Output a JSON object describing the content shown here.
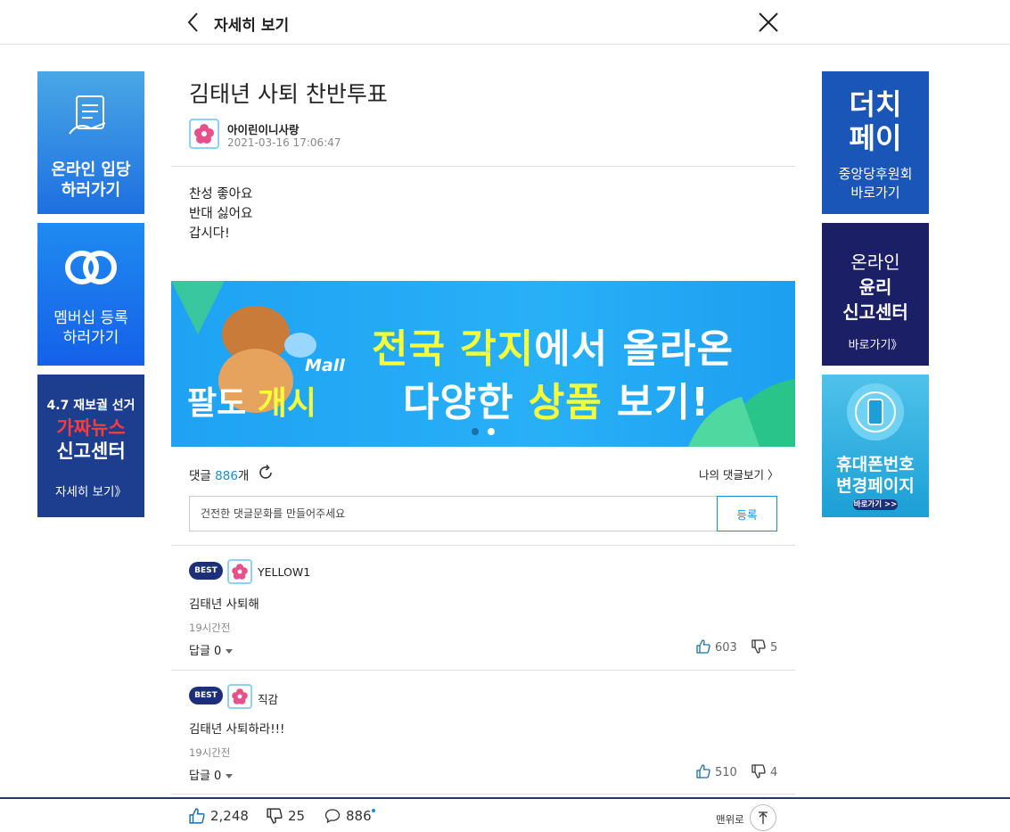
{
  "header": {
    "title": "자세히 보기"
  },
  "article": {
    "title": "김태년 사퇴 찬반투표",
    "author": "아이린이니사랑",
    "date": "2021-03-16 17:06:47",
    "body": [
      "찬성 좋아요",
      "반대 싫어요",
      "갑시다!"
    ]
  },
  "left_banners": [
    {
      "line1": "온라인 입당",
      "line2": "하러가기"
    },
    {
      "line1": "멤버십 등록",
      "line2": "하러가기"
    },
    {
      "line1": "4.7 재보궐 선거",
      "line2": "가짜뉴스",
      "line3": "신고센터",
      "line4": "자세히 보기》"
    }
  ],
  "right_banners": [
    {
      "line1": "더치",
      "line2": "페이",
      "line3": "중앙당후원회",
      "line4": "바로가기"
    },
    {
      "line1": "온라인",
      "line2": "윤리",
      "line3": "신고센터",
      "line4": "바로가기》"
    },
    {
      "line1": "휴대폰번호",
      "line2": "변경페이지",
      "line3": "바로가기 >>"
    }
  ],
  "promo": {
    "brand_a": "팔도 ",
    "brand_b": "개시",
    "mall": "Mall",
    "line1_a": "전국 각지",
    "line1_b": "에서 올라온",
    "line2_a": "다양한 ",
    "line2_b": "상품",
    "line2_c": " 보기!"
  },
  "comments_section": {
    "label": "댓글 ",
    "count": "886",
    "suffix": "개",
    "my_comments": "나의 댓글보기 〉",
    "placeholder": "건전한 댓글문화를 만들어주세요",
    "submit": "등록"
  },
  "comments": [
    {
      "badge": "BEST",
      "name": "YELLOW1",
      "text": "김태년 사퇴해",
      "time": "19시간전",
      "reply": "답글 0",
      "likes": "603",
      "dislikes": "5"
    },
    {
      "badge": "BEST",
      "name": "직감",
      "text": "김태년 사퇴하라!!!",
      "time": "19시간전",
      "reply": "답글 0",
      "likes": "510",
      "dislikes": "4"
    }
  ],
  "bottom_bar": {
    "likes": "2,248",
    "dislikes": "25",
    "comments": "886",
    "to_top": "맨위로"
  }
}
